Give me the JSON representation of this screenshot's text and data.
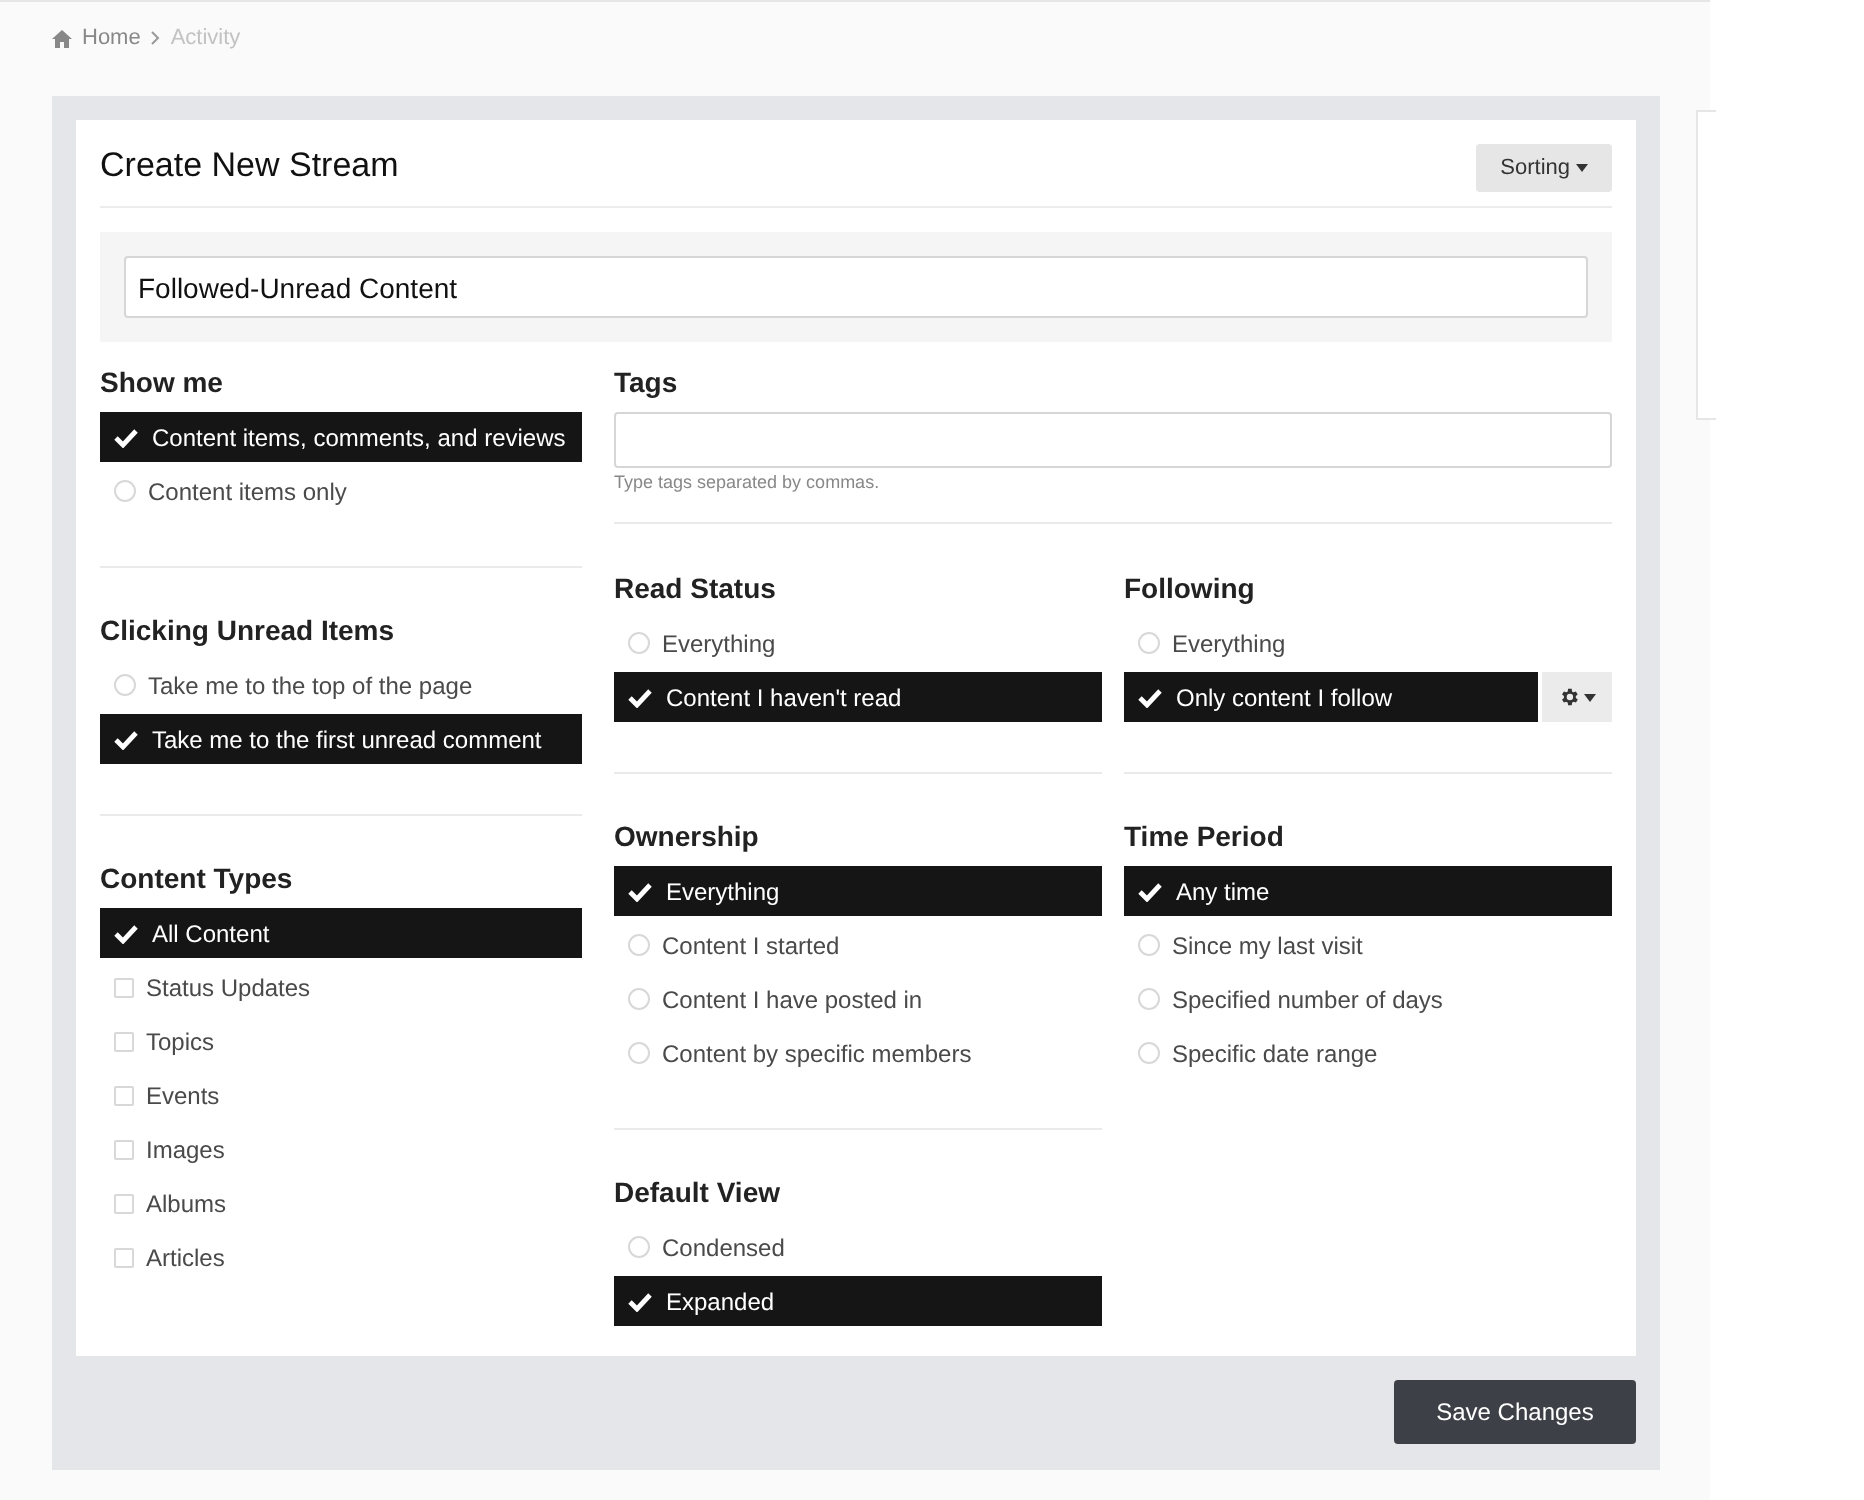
{
  "breadcrumb": [
    {
      "label": "Home",
      "current": false
    },
    {
      "label": "Activity",
      "current": true
    }
  ],
  "title": "Create New Stream",
  "sorting_button": "Sorting",
  "stream_name": "Followed-Unread Content",
  "tags": {
    "label": "Tags",
    "hint": "Type tags separated by commas."
  },
  "left_column": [
    {
      "title": "Show me",
      "options": [
        {
          "label": "Content items, comments, and reviews",
          "selected": true
        },
        {
          "label": "Content items only",
          "kind": "radio",
          "selected": false
        }
      ]
    },
    {
      "title": "Clicking Unread Items",
      "options": [
        {
          "label": "Take me to the top of the page",
          "kind": "radio",
          "selected": false
        },
        {
          "label": "Take me to the first unread comment",
          "selected": true
        }
      ]
    },
    {
      "title": "Content Types",
      "options": [
        {
          "label": "All Content",
          "selected": true
        },
        {
          "label": "Status Updates",
          "kind": "checkbox",
          "selected": false
        },
        {
          "label": "Topics",
          "kind": "checkbox",
          "selected": false
        },
        {
          "label": "Events",
          "kind": "checkbox",
          "selected": false
        },
        {
          "label": "Images",
          "kind": "checkbox",
          "selected": false
        },
        {
          "label": "Albums",
          "kind": "checkbox",
          "selected": false
        },
        {
          "label": "Articles",
          "kind": "checkbox",
          "selected": false
        }
      ]
    }
  ],
  "middle_column": [
    {
      "title": "Read Status",
      "options": [
        {
          "label": "Everything",
          "kind": "radio",
          "selected": false
        },
        {
          "label": "Content I haven't read",
          "selected": true
        }
      ]
    },
    {
      "title": "Ownership",
      "options": [
        {
          "label": "Everything",
          "selected": true
        },
        {
          "label": "Content I started",
          "kind": "radio",
          "selected": false
        },
        {
          "label": "Content I have posted in",
          "kind": "radio",
          "selected": false
        },
        {
          "label": "Content by specific members",
          "kind": "radio",
          "selected": false
        }
      ]
    },
    {
      "title": "Default View",
      "options": [
        {
          "label": "Condensed",
          "kind": "radio",
          "selected": false
        },
        {
          "label": "Expanded",
          "selected": true
        }
      ]
    }
  ],
  "right_column": [
    {
      "title": "Following",
      "options": [
        {
          "label": "Everything",
          "kind": "radio",
          "selected": false
        },
        {
          "label": "Only content I follow",
          "selected": true,
          "options_menu": true
        }
      ]
    },
    {
      "title": "Time Period",
      "options": [
        {
          "label": "Any time",
          "selected": true
        },
        {
          "label": "Since my last visit",
          "kind": "radio",
          "selected": false
        },
        {
          "label": "Specified number of days",
          "kind": "radio",
          "selected": false
        },
        {
          "label": "Specific date range",
          "kind": "radio",
          "selected": false
        }
      ]
    }
  ],
  "save_button": "Save Changes"
}
